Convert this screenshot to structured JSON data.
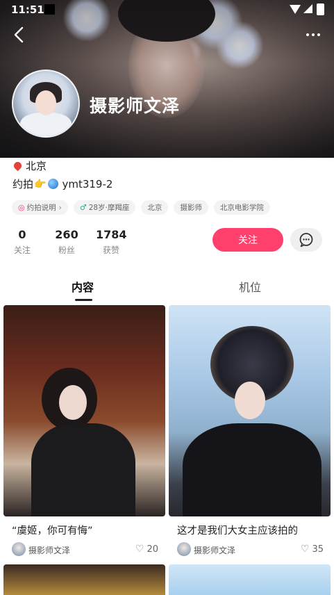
{
  "status_bar": {
    "time": "11:51"
  },
  "profile": {
    "name": "摄影师文泽",
    "location": "北京",
    "bio_prefix": "约拍",
    "bio_finger": "👉",
    "bio_id": "ymt319-2"
  },
  "tags": [
    {
      "label": "约拍说明",
      "icon": "camera-icon",
      "color": "#ff3f6c"
    },
    {
      "label": "28岁·摩羯座",
      "icon": "male-icon",
      "color": "#22b39a"
    },
    {
      "label": "北京"
    },
    {
      "label": "摄影师"
    },
    {
      "label": "北京电影学院"
    }
  ],
  "stats": [
    {
      "value": "0",
      "label": "关注"
    },
    {
      "value": "260",
      "label": "粉丝"
    },
    {
      "value": "1784",
      "label": "获赞"
    }
  ],
  "actions": {
    "follow_label": "关注"
  },
  "tabs": [
    {
      "label": "内容",
      "active": true
    },
    {
      "label": "机位",
      "active": false
    }
  ],
  "posts": [
    {
      "caption": "“虞姬，你可有悔”",
      "author": "摄影师文泽",
      "likes": "20"
    },
    {
      "caption": "这才是我们大女主应该拍的",
      "author": "摄影师文泽",
      "likes": "35"
    }
  ],
  "colors": {
    "accent": "#ff3f6c"
  }
}
